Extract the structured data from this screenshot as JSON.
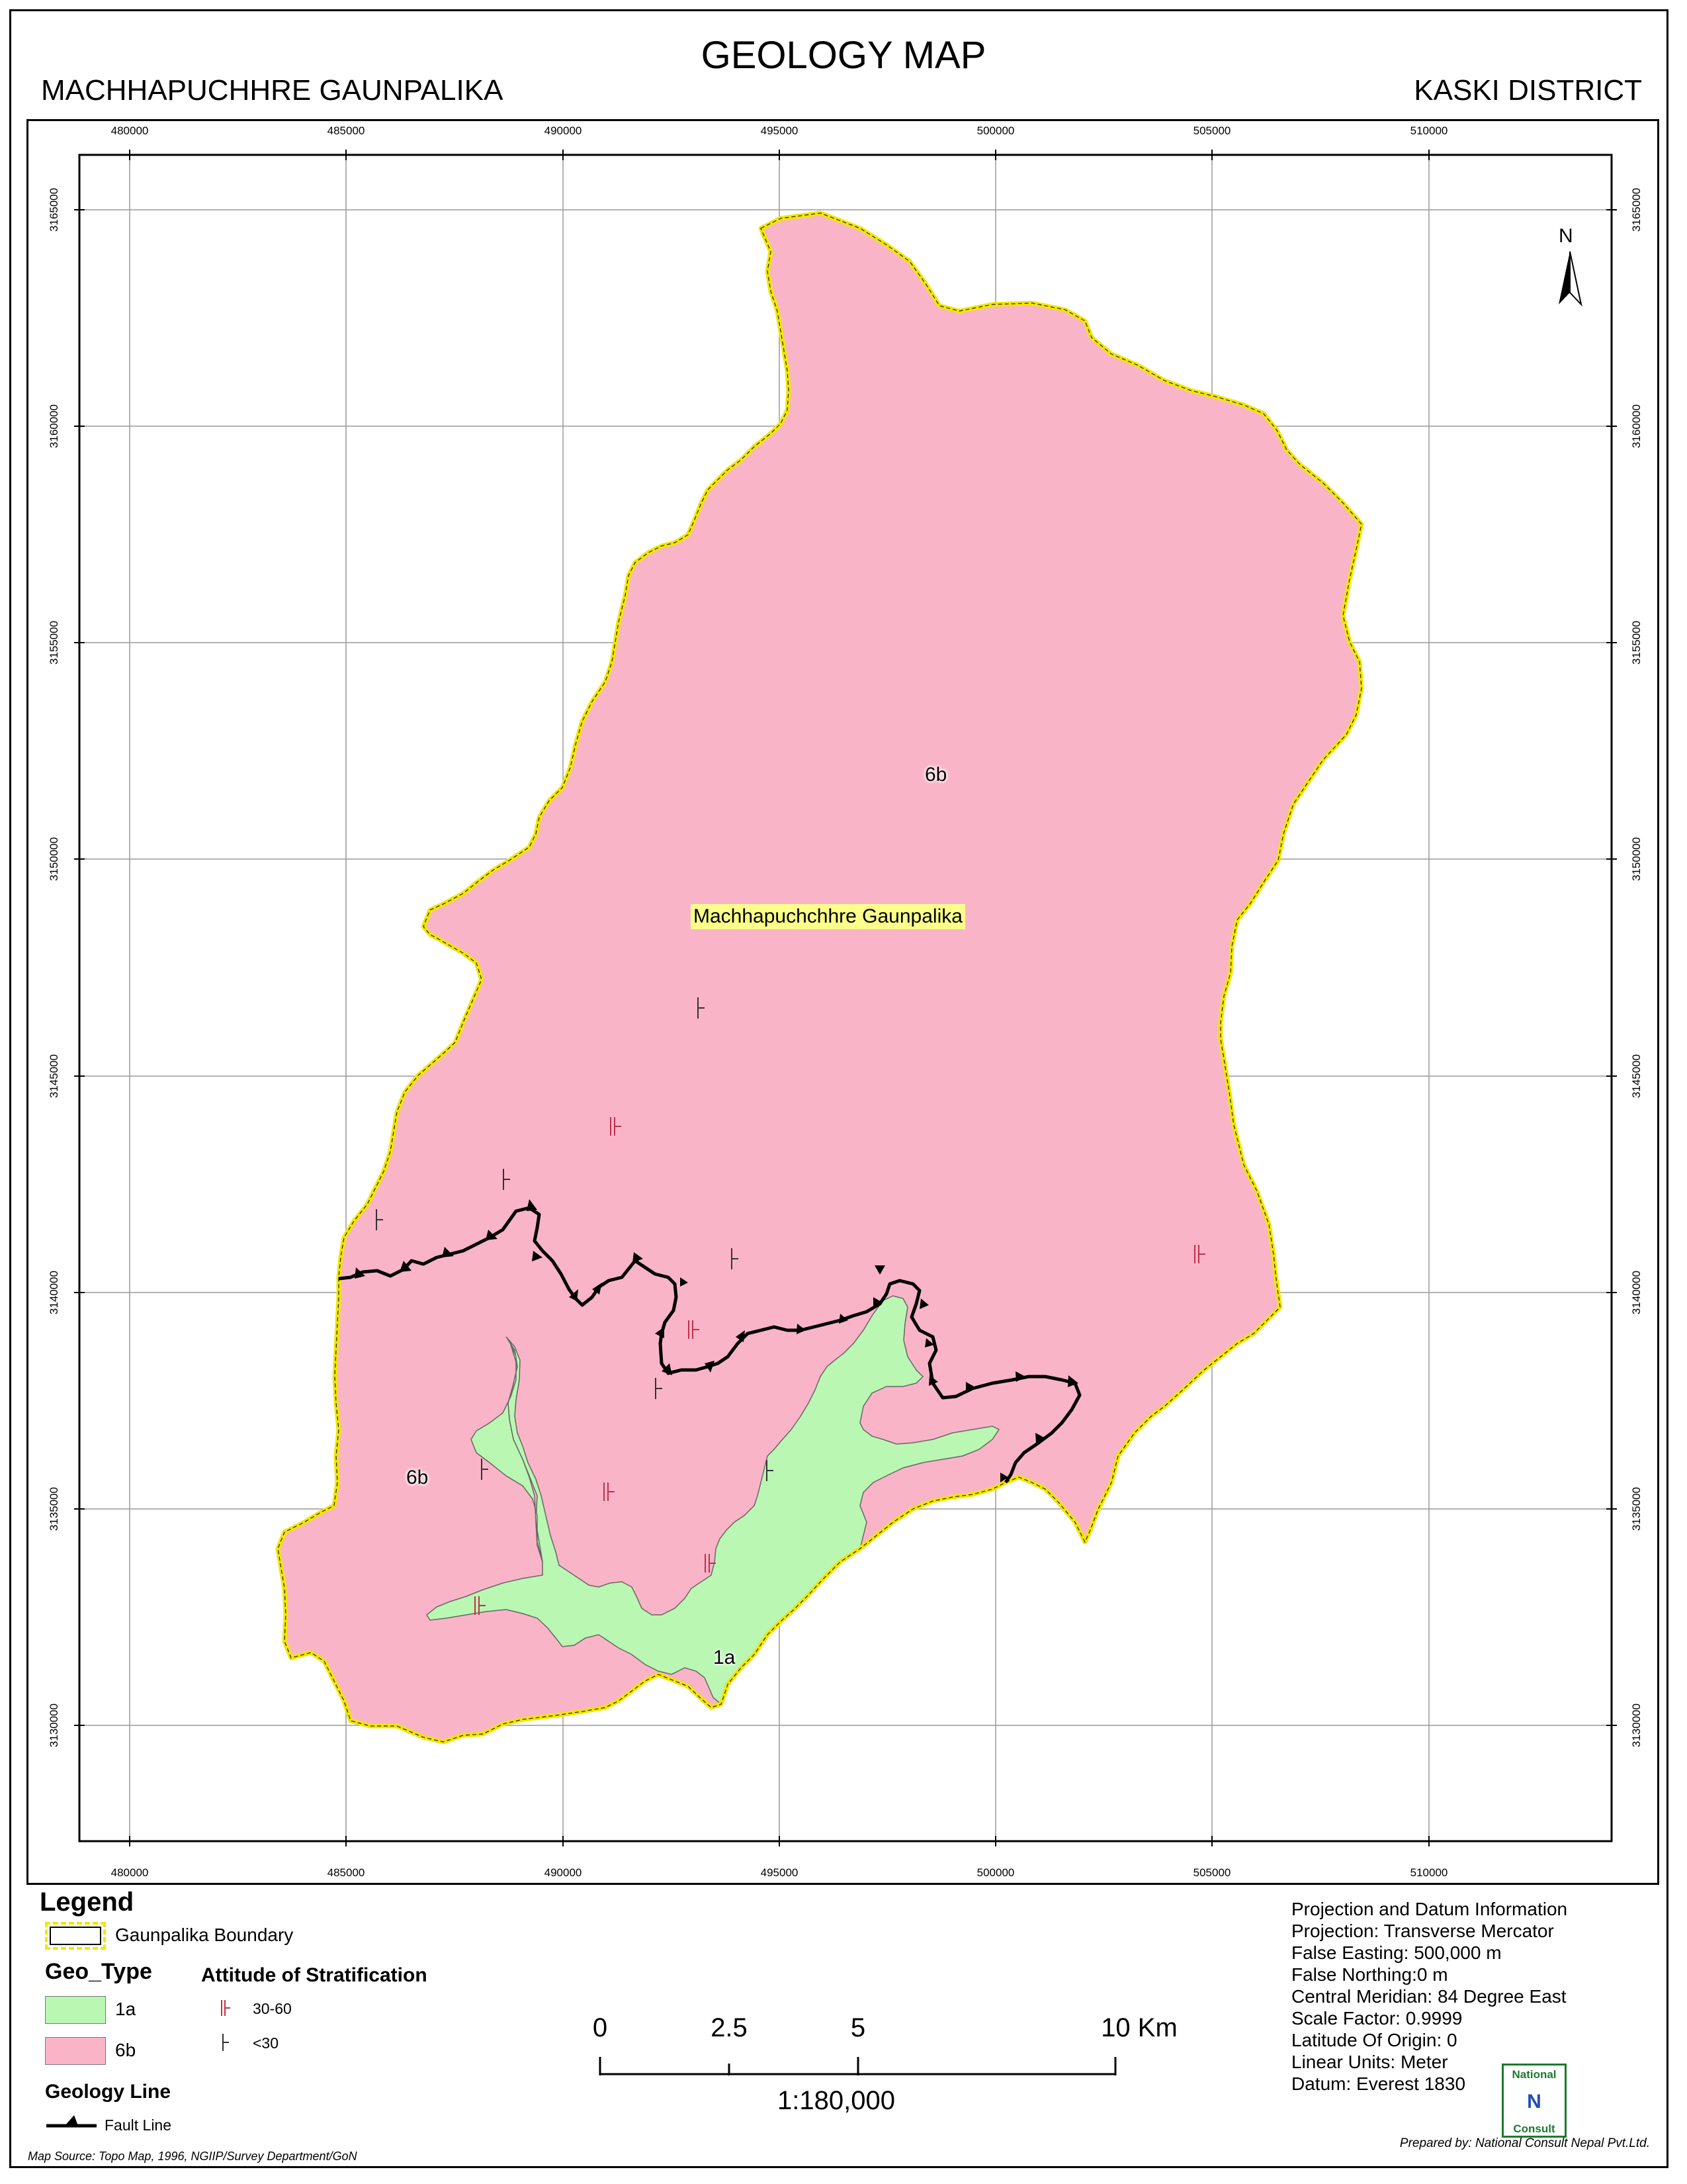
{
  "title": "GEOLOGY MAP",
  "subtitle_left": "MACHHAPUCHHRE GAUNPALIKA",
  "subtitle_right": "KASKI DISTRICT",
  "grid": {
    "eastings": [
      "480000",
      "485000",
      "490000",
      "495000",
      "500000",
      "505000",
      "510000"
    ],
    "northings": [
      "3165000",
      "3160000",
      "3155000",
      "3150000",
      "3145000",
      "3140000",
      "3135000",
      "3130000"
    ]
  },
  "map_labels": {
    "municipality": "Machhapuchchhre Gaunpalika",
    "unit_6b_north": "6b",
    "unit_6b_south": "6b",
    "unit_1a": "1a"
  },
  "north_arrow": "N",
  "legend": {
    "title": "Legend",
    "boundary_label": "Gaunpalika Boundary",
    "geo_type_heading": "Geo_Type",
    "geo_types": [
      {
        "code": "1a",
        "color": "#b9f7b3"
      },
      {
        "code": "6b",
        "color": "#f9b5c7"
      }
    ],
    "attitude_heading": "Attitude of Stratification",
    "attitudes": [
      "30-60",
      "<30"
    ],
    "geology_line_heading": "Geology Line",
    "fault_line_label": "Fault Line"
  },
  "scale_bar": {
    "ticks": [
      "0",
      "2.5",
      "5",
      "10 Km"
    ],
    "ratio": "1:180,000"
  },
  "projection": {
    "heading": "Projection and Datum Information",
    "lines": [
      "Projection: Transverse Mercator",
      "False Easting: 500,000 m",
      "False Northing:0 m",
      "Central Meridian: 84 Degree East",
      "Scale Factor: 0.9999",
      "Latitude Of Origin: 0",
      "Linear Units: Meter",
      "Datum: Everest 1830"
    ]
  },
  "logo": {
    "top": "National",
    "letter": "N",
    "bottom": "Consult"
  },
  "source_note": "Map Source: Topo Map, 1996, NGIIP/Survey Department/GoN",
  "prepared_note": "Prepared by: National Consult Nepal Pvt.Ltd.",
  "colors": {
    "unit_6b": "#f9b5c7",
    "unit_1a": "#b9f7b3",
    "boundary": "#f2e600",
    "fault": "#000000",
    "attitude_symbol": "#c0304a"
  }
}
